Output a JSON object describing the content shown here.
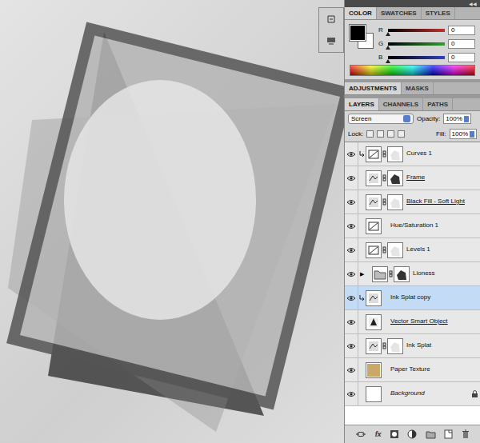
{
  "panel_collapse": "◀◀",
  "color_panel": {
    "tabs": [
      {
        "label": "COLOR",
        "selected": true
      },
      {
        "label": "SWATCHES",
        "selected": false
      },
      {
        "label": "STYLES",
        "selected": false
      }
    ],
    "channels": [
      {
        "name": "R",
        "value": "0",
        "level": 0,
        "color": "#c03030"
      },
      {
        "name": "G",
        "value": "0",
        "level": 0,
        "color": "#30a030"
      },
      {
        "name": "B",
        "value": "0",
        "level": 0,
        "color": "#3040c0"
      }
    ]
  },
  "adjust_tabs": [
    {
      "label": "ADJUSTMENTS",
      "selected": true
    },
    {
      "label": "MASKS",
      "selected": false
    }
  ],
  "layers_panel": {
    "tabs": [
      {
        "label": "LAYERS",
        "selected": true
      },
      {
        "label": "CHANNELS",
        "selected": false
      },
      {
        "label": "PATHS",
        "selected": false
      }
    ],
    "blend_mode": "Screen",
    "opacity_label": "Opacity:",
    "opacity": "100%",
    "lock_label": "Lock:",
    "fill_label": "Fill:",
    "fill": "100%",
    "layers": [
      {
        "name": "Curves 1",
        "visible": true,
        "selected": false,
        "clipped": true,
        "has_mask": true,
        "underlined": false,
        "italic": false,
        "locked": false,
        "kind": "adjustment"
      },
      {
        "name": "Frame",
        "visible": true,
        "selected": false,
        "clipped": false,
        "has_mask": true,
        "underlined": true,
        "italic": false,
        "locked": false,
        "kind": "layer"
      },
      {
        "name": "Black Fill - Soft Light",
        "visible": true,
        "selected": false,
        "clipped": false,
        "has_mask": true,
        "underlined": true,
        "italic": false,
        "locked": false,
        "kind": "layer"
      },
      {
        "name": "Hue/Saturation 1",
        "visible": true,
        "selected": false,
        "clipped": false,
        "has_mask": false,
        "underlined": false,
        "italic": false,
        "locked": false,
        "kind": "adjustment"
      },
      {
        "name": "Levels 1",
        "visible": true,
        "selected": false,
        "clipped": false,
        "has_mask": true,
        "underlined": false,
        "italic": false,
        "locked": false,
        "kind": "adjustment"
      },
      {
        "name": "Lioness",
        "visible": true,
        "selected": false,
        "clipped": false,
        "has_mask": true,
        "underlined": false,
        "italic": false,
        "locked": false,
        "kind": "group",
        "expander": "▶"
      },
      {
        "name": "Ink Splat copy",
        "visible": true,
        "selected": true,
        "clipped": true,
        "has_mask": false,
        "underlined": false,
        "italic": false,
        "locked": false,
        "kind": "layer"
      },
      {
        "name": "Vector Smart Object",
        "visible": true,
        "selected": false,
        "clipped": false,
        "has_mask": false,
        "underlined": true,
        "italic": false,
        "locked": false,
        "kind": "smart"
      },
      {
        "name": "Ink Splat",
        "visible": true,
        "selected": false,
        "clipped": false,
        "has_mask": true,
        "underlined": false,
        "italic": false,
        "locked": false,
        "kind": "layer"
      },
      {
        "name": "Paper Texture",
        "visible": true,
        "selected": false,
        "clipped": false,
        "has_mask": false,
        "underlined": false,
        "italic": false,
        "locked": false,
        "kind": "texture"
      },
      {
        "name": "Background",
        "visible": true,
        "selected": false,
        "clipped": false,
        "has_mask": false,
        "underlined": false,
        "italic": true,
        "locked": true,
        "kind": "background"
      }
    ],
    "footer_fx": "fx"
  }
}
